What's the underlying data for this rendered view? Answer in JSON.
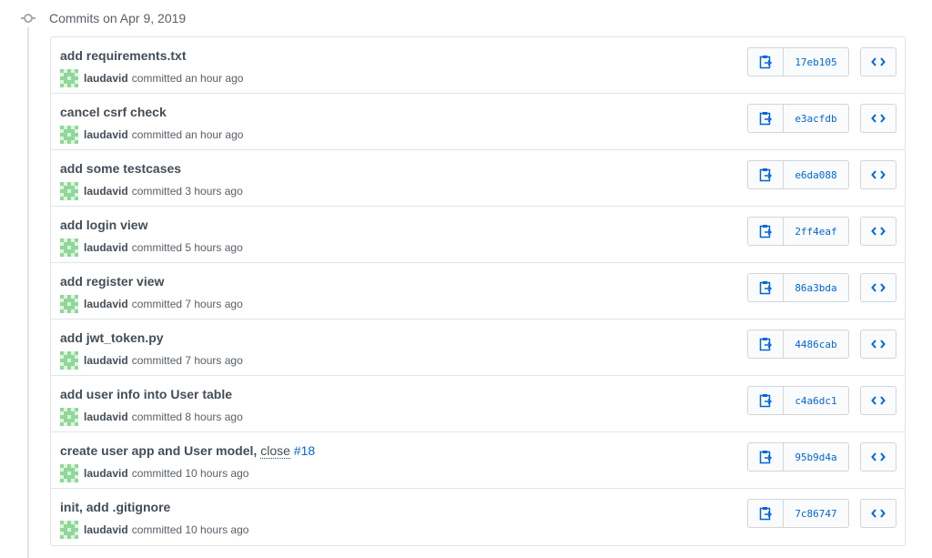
{
  "group": {
    "title": "Commits on Apr 9, 2019"
  },
  "colors": {
    "link": "#0366d6",
    "border": "#e1e4e8",
    "text": "#444d56",
    "muted": "#586069"
  },
  "commits": [
    {
      "message": "add requirements.txt",
      "author": "laudavid",
      "time": "committed an hour ago",
      "sha": "17eb105"
    },
    {
      "message": "cancel csrf check",
      "author": "laudavid",
      "time": "committed an hour ago",
      "sha": "e3acfdb"
    },
    {
      "message": "add some testcases",
      "author": "laudavid",
      "time": "committed 3 hours ago",
      "sha": "e6da088"
    },
    {
      "message": "add login view",
      "author": "laudavid",
      "time": "committed 5 hours ago",
      "sha": "2ff4eaf"
    },
    {
      "message": "add register view",
      "author": "laudavid",
      "time": "committed 7 hours ago",
      "sha": "86a3bda"
    },
    {
      "message": "add jwt_token.py",
      "author": "laudavid",
      "time": "committed 7 hours ago",
      "sha": "4486cab"
    },
    {
      "message": "add user info into User table",
      "author": "laudavid",
      "time": "committed 8 hours ago",
      "sha": "c4a6dc1"
    },
    {
      "message": "create user app and User model, ",
      "message_link": "close",
      "message_issue": "#18",
      "author": "laudavid",
      "time": "committed 10 hours ago",
      "sha": "95b9d4a"
    },
    {
      "message": "init, add .gitignore",
      "author": "laudavid",
      "time": "committed 10 hours ago",
      "sha": "7c86747"
    }
  ],
  "icons": {
    "group": "git-commit-icon",
    "copy": "clipboard-icon",
    "browse": "code-icon",
    "avatar": "identicon-avatar"
  }
}
